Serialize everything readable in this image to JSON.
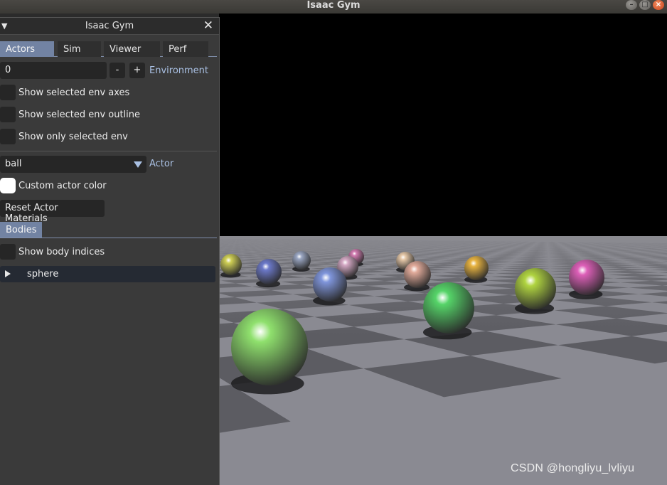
{
  "window": {
    "title": "Isaac Gym",
    "buttons": {
      "minimize": "–",
      "maximize": "□",
      "close": "×"
    }
  },
  "panel": {
    "title": "Isaac Gym",
    "collapse_icon": "triangle-down-icon",
    "close_glyph": "✕",
    "tabs": [
      {
        "label": "Actors",
        "active": true
      },
      {
        "label": "Sim",
        "active": false
      },
      {
        "label": "Viewer",
        "active": false
      },
      {
        "label": "Perf",
        "active": false
      }
    ],
    "environment": {
      "value": "0",
      "minus": "-",
      "plus": "+",
      "label": "Environment"
    },
    "checkboxes_env": [
      {
        "label": "Show selected env axes",
        "checked": false
      },
      {
        "label": "Show selected env outline",
        "checked": false
      },
      {
        "label": "Show only selected env",
        "checked": false
      }
    ],
    "actor": {
      "selected": "ball",
      "label": "Actor"
    },
    "custom_color": {
      "label": "Custom actor color",
      "swatch": "#ffffff"
    },
    "reset_button": "Reset Actor Materials",
    "bodies_header": "Bodies",
    "show_body_indices": {
      "label": "Show body indices",
      "checked": false
    },
    "tree": [
      {
        "label": "sphere",
        "expanded": false
      }
    ]
  },
  "colors": {
    "accent": "#7283a3",
    "label_blue": "#a9c0e3",
    "panel_bg": "#3a3a3a",
    "ground_light": "#8a8a92",
    "ground_dark": "#5c5c62"
  },
  "viewport": {
    "balls": [
      {
        "color": "#cfcf55"
      },
      {
        "color": "#6c79c9"
      },
      {
        "color": "#9aa6c2"
      },
      {
        "color": "#d17bb0"
      },
      {
        "color": "#d4a8c4"
      },
      {
        "color": "#e6c8a8"
      },
      {
        "color": "#e1aa9a"
      },
      {
        "color": "#e8b340"
      },
      {
        "color": "#7f95db"
      },
      {
        "color": "#b0d440"
      },
      {
        "color": "#dd5fb8"
      },
      {
        "color": "#55d468"
      },
      {
        "color": "#8fe06d"
      }
    ]
  },
  "watermark": "CSDN @hongliyu_lvliyu"
}
